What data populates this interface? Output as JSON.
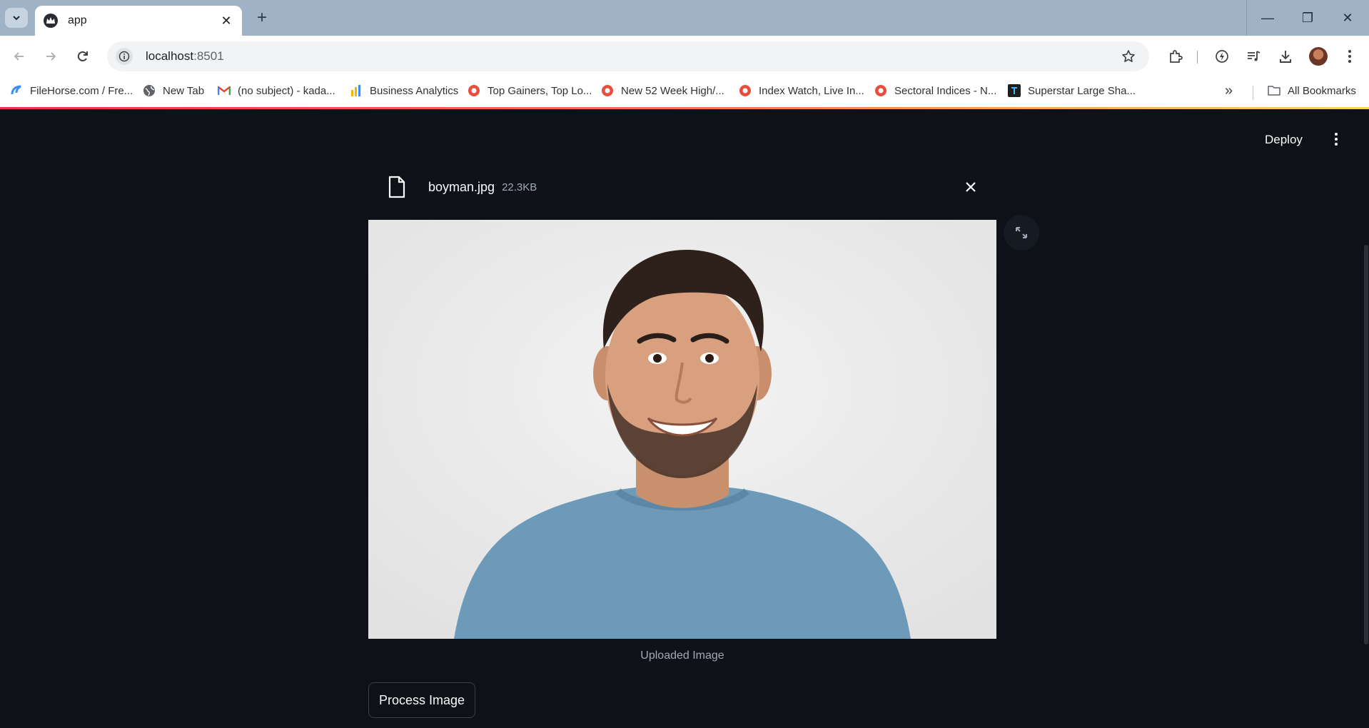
{
  "browser": {
    "tab_title": "app",
    "new_tab_symbol": "+",
    "close_tab_symbol": "✕",
    "url_host": "localhost",
    "url_port": ":8501",
    "window_controls": {
      "minimize": "—",
      "restore": "❐",
      "close": "✕"
    }
  },
  "bookmarks": {
    "items": [
      {
        "label": "FileHorse.com / Fre...",
        "icon": "filehorse-icon",
        "color": "#3b8ef0"
      },
      {
        "label": "New Tab",
        "icon": "globe-icon",
        "color": "#5f6368"
      },
      {
        "label": "(no subject) - kada...",
        "icon": "gmail-icon",
        "color": "#ea4335"
      },
      {
        "label": "Business Analytics",
        "icon": "analytics-icon",
        "color": "#f4b400"
      },
      {
        "label": "Top Gainers, Top Lo...",
        "icon": "moneycontrol-icon",
        "color": "#e94e3c"
      },
      {
        "label": "New 52 Week High/...",
        "icon": "moneycontrol-icon",
        "color": "#e94e3c"
      },
      {
        "label": "Index Watch, Live In...",
        "icon": "moneycontrol-icon",
        "color": "#e94e3c"
      },
      {
        "label": "Sectoral Indices - N...",
        "icon": "moneycontrol-icon",
        "color": "#e94e3c"
      },
      {
        "label": "Superstar Large Sha...",
        "icon": "tradingview-icon",
        "color": "#1e1e1e"
      }
    ],
    "more_symbol": "»",
    "all_bookmarks": "All Bookmarks"
  },
  "app": {
    "deploy_label": "Deploy",
    "file": {
      "name": "boyman.jpg",
      "size": "22.3KB"
    },
    "image_caption": "Uploaded Image",
    "process_button": "Process Image"
  },
  "colors": {
    "app_background": "#0e1117",
    "text_primary": "#fafafa",
    "text_muted": "#a3a8b8",
    "shirt_blue": "#6e9ab9"
  }
}
